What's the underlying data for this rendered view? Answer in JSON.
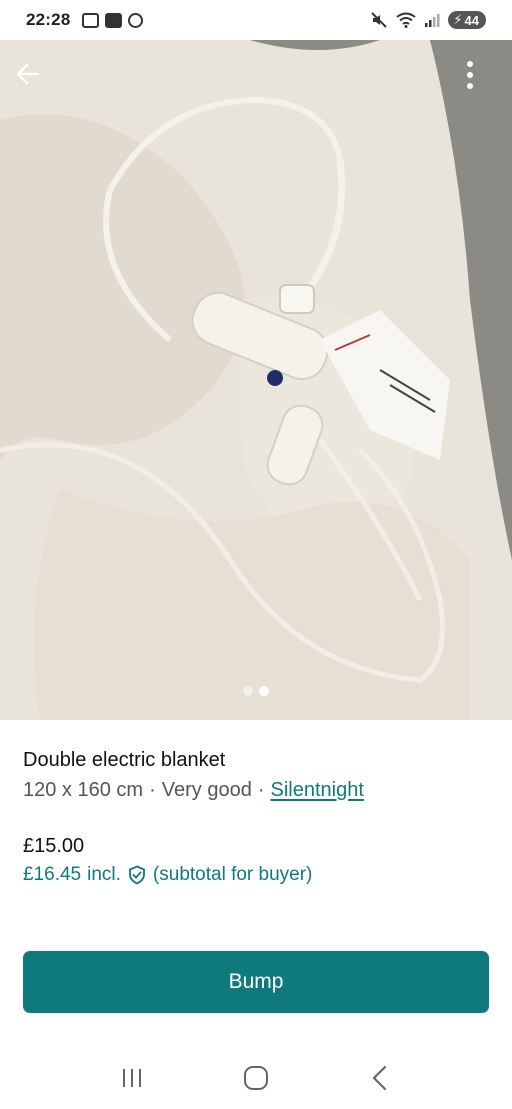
{
  "status_bar": {
    "time": "22:28",
    "battery": "44",
    "icons": [
      "screenshot-icon",
      "mail-icon",
      "chrome-icon",
      "mute-icon",
      "wifi-icon",
      "signal-icon"
    ]
  },
  "gallery": {
    "image_count": 2,
    "active_index": 1
  },
  "listing": {
    "title": "Double electric blanket",
    "size": "120 x 160 cm",
    "separator": "·",
    "condition": "Very good",
    "brand": "Silentnight",
    "price": "£15.00",
    "buyer_price": "£16.45",
    "incl_label": "incl.",
    "buyer_note": "(subtotal for buyer)"
  },
  "actions": {
    "bump_label": "Bump"
  },
  "colors": {
    "accent": "#0f7a7e"
  }
}
